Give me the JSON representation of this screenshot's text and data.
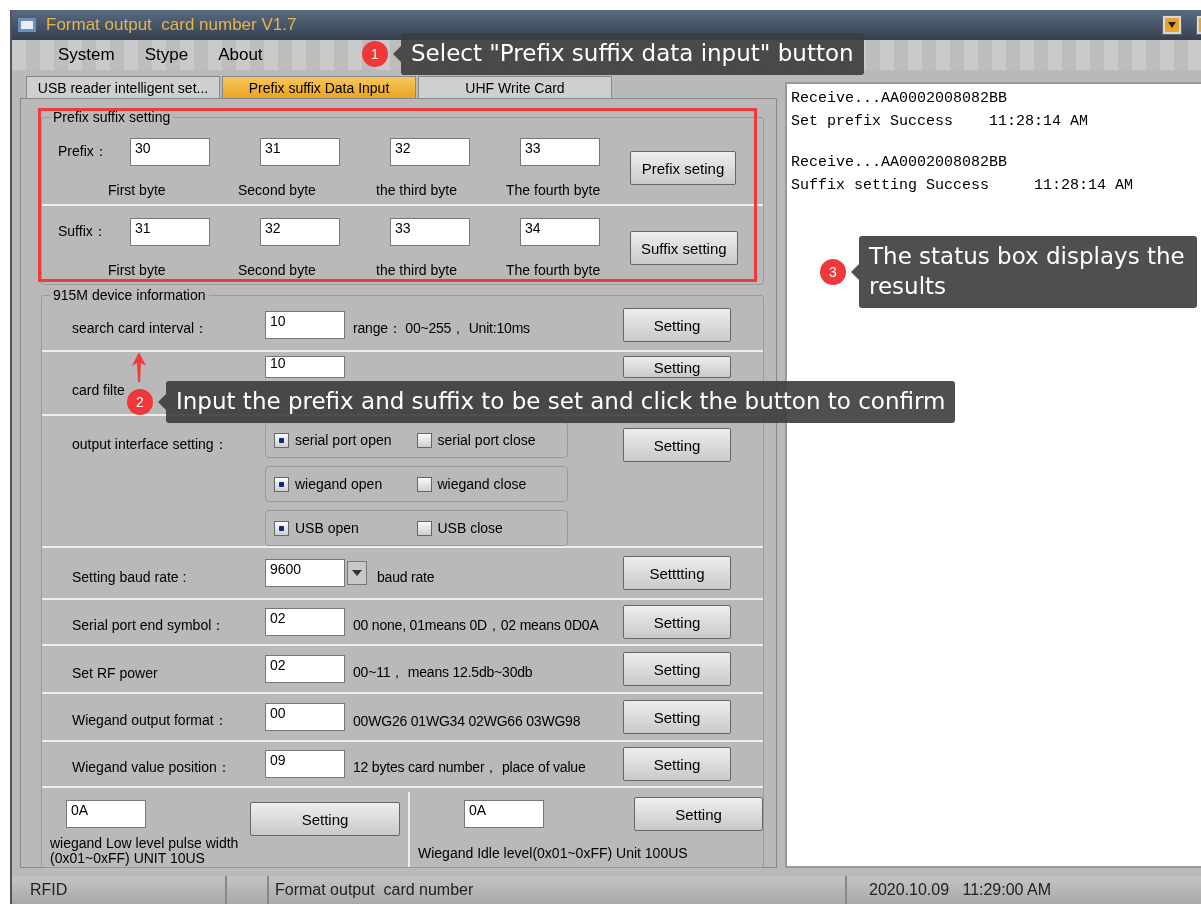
{
  "window": {
    "title": "Format output  card number V1.7"
  },
  "menu": [
    {
      "label": "System"
    },
    {
      "label": "Stype"
    },
    {
      "label": "About"
    }
  ],
  "tabs": [
    {
      "label": "USB reader intelligent set...",
      "selected": false
    },
    {
      "label": "Prefix suffix Data Input",
      "selected": true
    },
    {
      "label": "UHF Write Card",
      "selected": false
    }
  ],
  "prefix_suffix": {
    "title": "Prefix suffix setting",
    "rows": [
      {
        "label": "Prefix：",
        "values": [
          "30",
          "31",
          "32",
          "33"
        ],
        "captions": [
          "First byte",
          "Second byte",
          "the third byte",
          "The fourth byte"
        ],
        "button": "Prefix seting"
      },
      {
        "label": "Suffix：",
        "values": [
          "31",
          "32",
          "33",
          "34"
        ],
        "captions": [
          "First byte",
          "Second byte",
          "the third byte",
          "The fourth byte"
        ],
        "button": "Suffix setting"
      }
    ]
  },
  "device_info": {
    "title": "915M device information",
    "rows": [
      {
        "kind": "field",
        "label": "search card interval：",
        "value": "10",
        "note": "range： 00~255， Unit:10ms",
        "button": "Setting"
      },
      {
        "kind": "field",
        "label": "card filte",
        "value": "10",
        "button": "Setting"
      },
      {
        "kind": "radio",
        "label": "output interface setting：",
        "groups": [
          {
            "options": [
              {
                "label": "serial port open",
                "selected": true
              },
              {
                "label": "serial port close",
                "selected": false
              }
            ]
          },
          {
            "options": [
              {
                "label": "wiegand open",
                "selected": true
              },
              {
                "label": "wiegand close",
                "selected": false
              }
            ]
          },
          {
            "options": [
              {
                "label": "USB open",
                "selected": true
              },
              {
                "label": "USB close",
                "selected": false
              }
            ]
          }
        ],
        "button": "Setting"
      },
      {
        "kind": "combo",
        "label": "Setting baud rate :",
        "value": "9600",
        "note": "baud rate",
        "button": "Setttting"
      },
      {
        "kind": "field",
        "label": "Serial port end symbol：",
        "value": "02",
        "note": "00 none, 01means 0D，02 means 0D0A",
        "button": "Setting"
      },
      {
        "kind": "field",
        "label": "Set RF power",
        "value": "02",
        "note": "00~11， means 12.5db~30db",
        "button": "Setting"
      },
      {
        "kind": "field",
        "label": "Wiegand output format：",
        "value": "00",
        "note": "00WG26 01WG34 02WG66 03WG98",
        "button": "Setting"
      },
      {
        "kind": "field",
        "label": "Wiegand value position：",
        "value": "09",
        "note": "12 bytes card number， place of value",
        "button": "Setting"
      },
      {
        "kind": "split",
        "parts": [
          {
            "value": "0A",
            "caption": "wiegand Low level pulse width (0x01~0xFF) UNIT 10US",
            "button": "Setting"
          },
          {
            "value": "0A",
            "caption": "Wiegand Idle level(0x01~0xFF) Unit 100US",
            "button": "Setting"
          }
        ]
      }
    ]
  },
  "status_box": {
    "entries": [
      [
        "Receive...AA0002008082BB",
        "Set prefix Success    11:28:14 AM"
      ],
      [
        "Receive...AA0002008082BB",
        "Suffix setting Success     11:28:14 AM"
      ]
    ]
  },
  "status_bar": [
    "RFID",
    "Format output  card number",
    "2020.10.09   11:29:00 AM"
  ],
  "callouts": [
    {
      "number": "1",
      "text": "Select \"Prefix suffix data input\" button"
    },
    {
      "number": "2",
      "text": "Input the prefix and suffix to be set and click the button to confirm"
    },
    {
      "number": "3",
      "text": "The status box displays the results"
    }
  ]
}
